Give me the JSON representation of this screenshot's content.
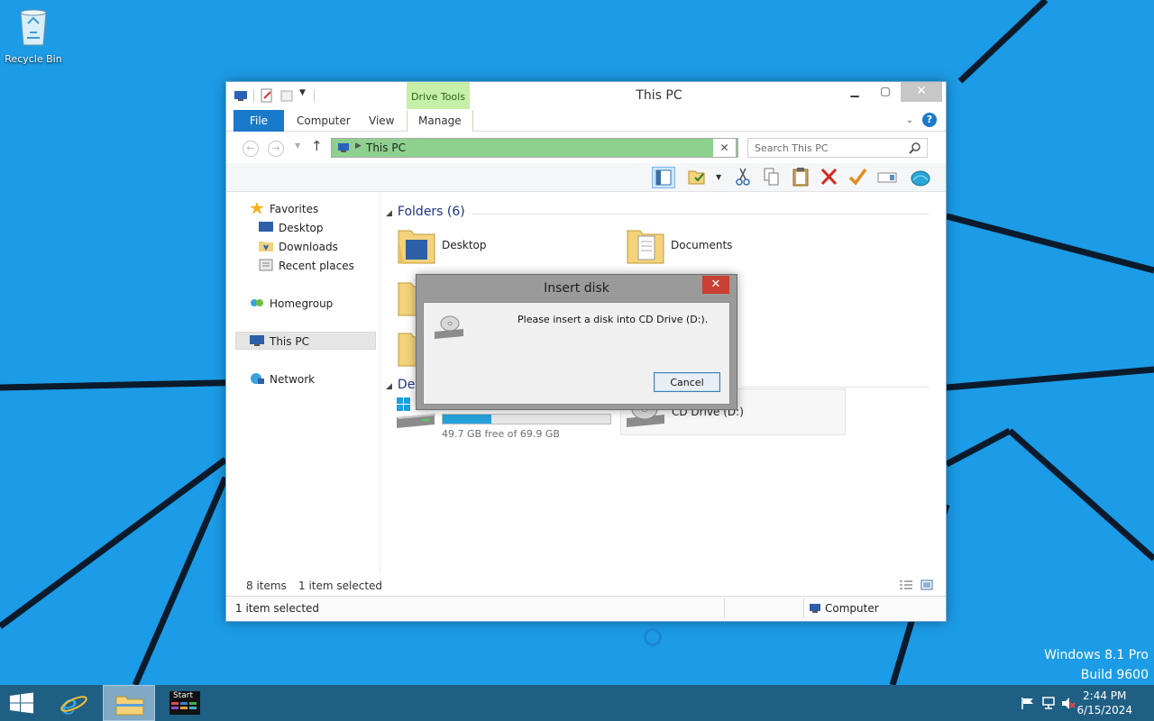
{
  "desktop": {
    "recycle_bin_label": "Recycle Bin",
    "watermark_line1": "Windows 8.1 Pro",
    "watermark_line2": "Build 9600"
  },
  "window": {
    "title": "This PC",
    "context_tab": "Drive Tools",
    "ribbon_tabs": [
      "File",
      "Computer",
      "View",
      "Manage"
    ],
    "address_text": "This PC",
    "search_placeholder": "Search This PC",
    "nav_pane": {
      "favorites": "Favorites",
      "desktop": "Desktop",
      "downloads": "Downloads",
      "recent_places": "Recent places",
      "homegroup": "Homegroup",
      "this_pc": "This PC",
      "network": "Network"
    },
    "folders_header": "Folders (6)",
    "folders": [
      "Desktop",
      "Documents"
    ],
    "devices_header": "Dev",
    "drives": {
      "c_free_text": "49.7 GB free of 69.9 GB",
      "c_used_fraction": 0.289,
      "d_label": "CD Drive (D:)"
    },
    "status": {
      "items": "8 items",
      "selected": "1 item selected",
      "bottom_selected": "1 item selected",
      "bottom_location": "Computer"
    }
  },
  "dialog": {
    "title": "Insert disk",
    "message": "Please insert a disk into CD Drive (D:).",
    "cancel_label": "Cancel"
  },
  "taskbar": {
    "start_tile_label": "Start",
    "time": "2:44 PM",
    "date": "6/15/2024"
  },
  "colors": {
    "desktop_bg": "#1c9be6",
    "taskbar_bg": "#205f84",
    "ribbon_file": "#1979ca",
    "address_highlight": "#8ed18e",
    "drive_tools_tab": "#c6f0a8",
    "dialog_close": "#c84031"
  }
}
